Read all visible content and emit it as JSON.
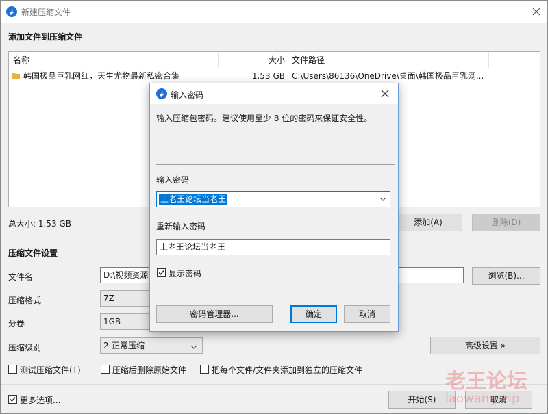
{
  "window": {
    "title": "新建压缩文件"
  },
  "add_section": {
    "title": "添加文件到压缩文件",
    "columns": {
      "name": "名称",
      "size": "大小",
      "path": "文件路径"
    },
    "rows": [
      {
        "name": "韩国极品巨乳网红，天生尤物最新私密合集",
        "size": "1.53 GB",
        "path": "C:\\Users\\86136\\OneDrive\\桌面\\韩国极品巨乳网..."
      }
    ],
    "total_size": "总大小: 1.53 GB",
    "add_button": "添加(A)",
    "delete_button": "删除(D)"
  },
  "settings": {
    "title": "压缩文件设置",
    "filename_label": "文件名",
    "filename_value": "D:\\视频资源\\",
    "browse_button": "浏览(B)...",
    "format_label": "压缩格式",
    "format_value": "7Z",
    "volume_label": "分卷",
    "volume_value": "1GB",
    "level_label": "压缩级别",
    "level_value": "2-正常压缩",
    "advanced_button": "高级设置 »",
    "test_checkbox": "测试压缩文件(T)",
    "delete_after_checkbox": "压缩后删除原始文件",
    "separate_checkbox": "把每个文件/文件夹添加到独立的压缩文件"
  },
  "footer": {
    "more_options": "更多选项...",
    "start_button": "开始(S)",
    "cancel_button": "取消"
  },
  "dialog": {
    "title": "输入密码",
    "hint": "输入压缩包密码。建议使用至少 8 位的密码来保证安全性。",
    "password_label": "输入密码",
    "password_value": "上老王论坛当老王",
    "reenter_label": "重新输入密码",
    "reenter_value": "上老王论坛当老王",
    "show_password": "显示密码",
    "manager_button": "密码管理器...",
    "ok_button": "确定",
    "cancel_button": "取消"
  },
  "watermark": {
    "line1": "老王论坛",
    "line2": "laowang.vip"
  },
  "colors": {
    "accent": "#0078d7",
    "app_icon": "#1e6fd9",
    "folder": "#e8b33a"
  }
}
